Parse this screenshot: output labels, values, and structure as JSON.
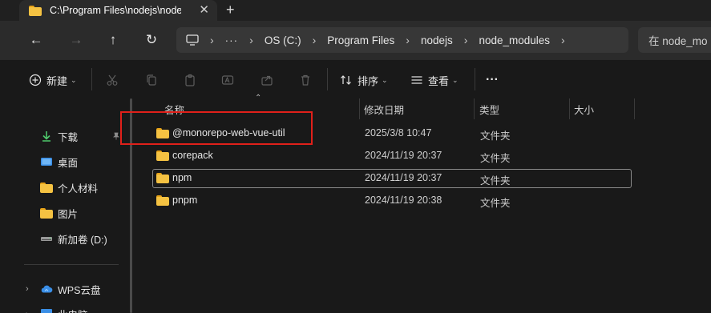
{
  "tab": {
    "title": "C:\\Program Files\\nodejs\\node_",
    "close": "✕",
    "new": "+"
  },
  "nav": {
    "back": "←",
    "forward": "→",
    "up": "↑",
    "refresh": "↻",
    "pc_icon": "monitor-icon",
    "breadcrumb": [
      "OS (C:)",
      "Program Files",
      "nodejs",
      "node_modules"
    ],
    "overflow": "···",
    "chevron": "›",
    "search_placeholder": "在 node_mo"
  },
  "toolbar": {
    "new_label": "新建",
    "sort_label": "排序",
    "view_label": "查看",
    "more": "···",
    "chevron": "⌄"
  },
  "columns": {
    "name": "名称",
    "modified": "修改日期",
    "type": "类型",
    "size": "大小"
  },
  "files": [
    {
      "name": "@monorepo-web-vue-util",
      "modified": "2025/3/8 10:47",
      "type": "文件夹",
      "size": ""
    },
    {
      "name": "corepack",
      "modified": "2024/11/19 20:37",
      "type": "文件夹",
      "size": ""
    },
    {
      "name": "npm",
      "modified": "2024/11/19 20:37",
      "type": "文件夹",
      "size": ""
    },
    {
      "name": "pnpm",
      "modified": "2024/11/19 20:38",
      "type": "文件夹",
      "size": ""
    }
  ],
  "sidebar": {
    "items": [
      {
        "label": "下载",
        "icon": "download-icon"
      },
      {
        "label": "桌面",
        "icon": "desktop-icon"
      },
      {
        "label": "个人材料",
        "icon": "folder-icon"
      },
      {
        "label": "图片",
        "icon": "folder-icon"
      },
      {
        "label": "新加卷 (D:)",
        "icon": "drive-icon"
      },
      {
        "label": "WPS云盘",
        "icon": "cloud-icon"
      },
      {
        "label": "此电脑",
        "icon": "monitor-icon"
      }
    ],
    "expander": "›",
    "pin": "📌"
  },
  "colors": {
    "highlight": "#e0201a",
    "folder": "#f5c242",
    "accent_download": "#4ec86b",
    "cloud": "#3a8ee6"
  }
}
